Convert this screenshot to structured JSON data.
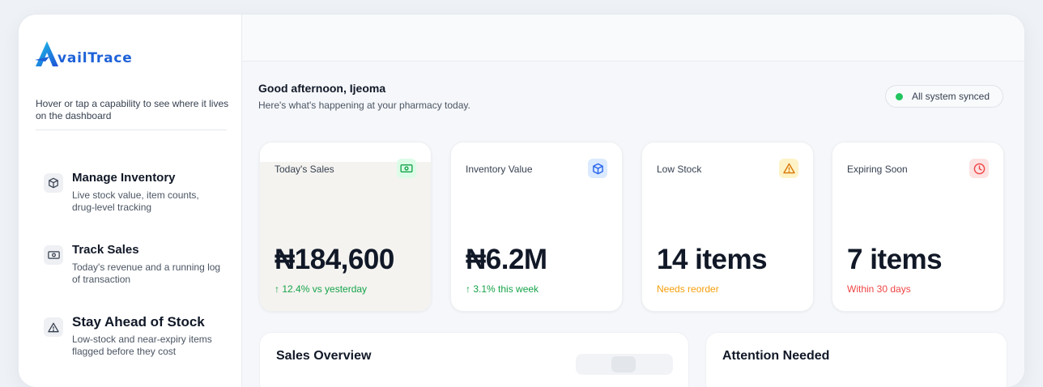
{
  "brand": {
    "logo_text": "vailTrace",
    "logo_mark": "A"
  },
  "sidebar": {
    "hint": "Hover or tap a capability to see where it lives on the dashboard",
    "capabilities": [
      {
        "icon": "box-icon",
        "title": "Manage Inventory",
        "desc": "Live stock value, item counts, drug-level tracking"
      },
      {
        "icon": "cash-icon",
        "title": "Track Sales",
        "desc": "Today's revenue and a running log of transaction"
      },
      {
        "icon": "warning-icon",
        "title": "Stay Ahead of Stock",
        "desc": "Low-stock and near-expiry items flagged before they cost"
      }
    ]
  },
  "header": {
    "greeting": "Good afternoon, Ijeoma",
    "subtitle": "Here's what's happening at your pharmacy today.",
    "sync_status": "All system synced"
  },
  "cards": [
    {
      "label": "Today's Sales",
      "icon": "cash-icon",
      "value": "₦184,600",
      "foot": "↑ 12.4% vs yesterday",
      "foot_color": "#16a34a",
      "icon_bg": "#dcfce7",
      "icon_color": "#16a34a"
    },
    {
      "label": "Inventory Value",
      "icon": "box-icon",
      "value": "₦6.2M",
      "foot": "↑ 3.1% this week",
      "foot_color": "#16a34a",
      "icon_bg": "#dbeafe",
      "icon_color": "#2563eb"
    },
    {
      "label": "Low Stock",
      "icon": "warning-icon",
      "value": "14 items",
      "foot": "Needs reorder",
      "foot_color": "#f59e0b",
      "icon_bg": "#fef3c7",
      "icon_color": "#d97706"
    },
    {
      "label": "Expiring Soon",
      "icon": "clock-icon",
      "value": "7 items",
      "foot": "Within 30 days",
      "foot_color": "#ef4444",
      "icon_bg": "#fee2e2",
      "icon_color": "#ef4444"
    }
  ],
  "panels": {
    "sales_overview": "Sales Overview",
    "attention_needed": "Attention Needed"
  }
}
